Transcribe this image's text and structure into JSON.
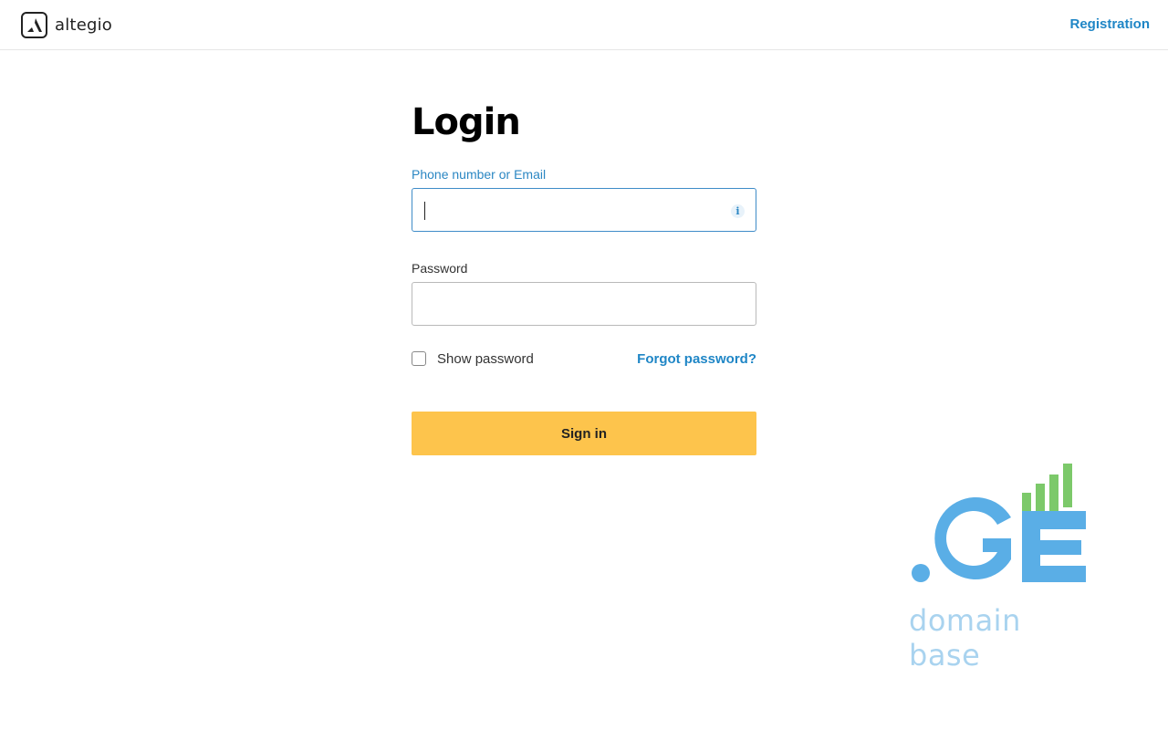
{
  "header": {
    "logo_text": "altegio",
    "registration_label": "Registration"
  },
  "form": {
    "title": "Login",
    "login_label": "Phone number or Email",
    "login_value": "",
    "login_placeholder": "",
    "password_label": "Password",
    "password_value": "",
    "show_password_label": "Show password",
    "show_password_checked": false,
    "forgot_password_label": "Forgot password?",
    "sign_in_label": "Sign in"
  },
  "watermark": {
    "logo_text": ".GE",
    "caption": "domain base"
  },
  "colors": {
    "link": "#1f86c6",
    "focus_border": "#3f8cc8",
    "button": "#fdc44c",
    "watermark_blue": "#5aaee6",
    "watermark_green": "#7cc96a"
  },
  "icons": {
    "logo": "altegio-logo-icon",
    "info": "info-icon"
  }
}
